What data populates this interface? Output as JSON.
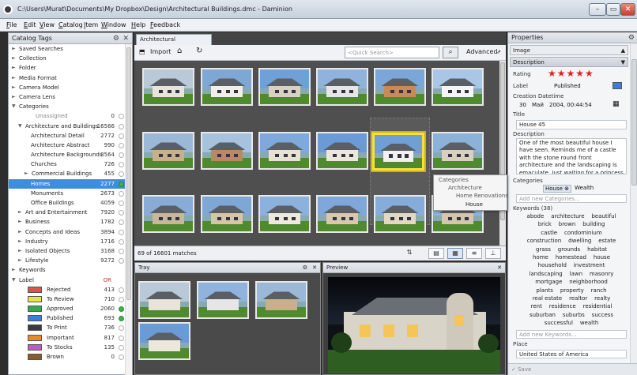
{
  "window": {
    "title": "C:\\Users\\Murat\\Documents\\My Dropbox\\Design\\Architectural Buildings.dmc - Daminion",
    "min": "–",
    "max": "▭",
    "close": "✕"
  },
  "menu": [
    "File",
    "Edit",
    "View",
    "Catalog",
    "Item",
    "Window",
    "Help",
    "Feedback"
  ],
  "left": {
    "title": "Catalog Tags",
    "items": [
      {
        "t": "Saved Searches",
        "d": 0,
        "a": "►"
      },
      {
        "t": "Collection",
        "d": 0,
        "a": "►"
      },
      {
        "t": "Folder",
        "d": 0,
        "a": "►"
      },
      {
        "t": "Media Format",
        "d": 0,
        "a": "►"
      },
      {
        "t": "Camera Model",
        "d": 0,
        "a": "►"
      },
      {
        "t": "Camera Lens",
        "d": 0,
        "a": "►"
      },
      {
        "t": "Categories",
        "d": 0,
        "a": "▼"
      },
      {
        "t": "Unassigned",
        "d": 2,
        "a": "",
        "c": "0",
        "dot": "w",
        "grey": true
      },
      {
        "t": "Architecture and Buildings",
        "d": 1,
        "a": "▼",
        "c": "16566",
        "dot": "w"
      },
      {
        "t": "Architectural Detail",
        "d": 3,
        "a": "",
        "c": "2772",
        "dot": "w"
      },
      {
        "t": "Architecture Abstract",
        "d": 3,
        "a": "",
        "c": "990",
        "dot": "w"
      },
      {
        "t": "Architecture Backgrounds",
        "d": 3,
        "a": "",
        "c": "3564",
        "dot": "w"
      },
      {
        "t": "Churches",
        "d": 3,
        "a": "",
        "c": "726",
        "dot": "w"
      },
      {
        "t": "Commercial Buildings",
        "d": 2,
        "a": "►",
        "c": "455",
        "dot": "w"
      },
      {
        "t": "Homes",
        "d": 3,
        "a": "",
        "c": "2277",
        "dot": "g",
        "sel": true
      },
      {
        "t": "Monuments",
        "d": 3,
        "a": "",
        "c": "2673",
        "dot": "w"
      },
      {
        "t": "Office Buildings",
        "d": 3,
        "a": "",
        "c": "4059",
        "dot": "w"
      },
      {
        "t": "Art and Entertainment",
        "d": 1,
        "a": "►",
        "c": "7920",
        "dot": "w"
      },
      {
        "t": "Business",
        "d": 1,
        "a": "►",
        "c": "1782",
        "dot": "w"
      },
      {
        "t": "Concepts and Ideas",
        "d": 1,
        "a": "►",
        "c": "3894",
        "dot": "w"
      },
      {
        "t": "Industry",
        "d": 1,
        "a": "►",
        "c": "1716",
        "dot": "w"
      },
      {
        "t": "Isolated Objects",
        "d": 1,
        "a": "►",
        "c": "3168",
        "dot": "w"
      },
      {
        "t": "Lifestyle",
        "d": 1,
        "a": "►",
        "c": "9272",
        "dot": "w"
      },
      {
        "t": "Keywords",
        "d": 0,
        "a": "►"
      },
      {
        "t": "Label",
        "d": 0,
        "a": "▼",
        "c": "OR",
        "dot": "",
        "or": true
      },
      {
        "t": "Rejected",
        "d": 4,
        "a": "",
        "c": "413",
        "dot": "w",
        "sw": "#d9534f"
      },
      {
        "t": "To Review",
        "d": 4,
        "a": "",
        "c": "710",
        "dot": "w",
        "sw": "#e5e54a"
      },
      {
        "t": "Approved",
        "d": 4,
        "a": "",
        "c": "2060",
        "dot": "g",
        "sw": "#3aa64a"
      },
      {
        "t": "Published",
        "d": 4,
        "a": "",
        "c": "693",
        "dot": "g",
        "sw": "#3d7ed8"
      },
      {
        "t": "To Print",
        "d": 4,
        "a": "",
        "c": "736",
        "dot": "w",
        "sw": "#3b3b3b"
      },
      {
        "t": "Important",
        "d": 4,
        "a": "",
        "c": "817",
        "dot": "w",
        "sw": "#e88a2a"
      },
      {
        "t": "To Stocks",
        "d": 4,
        "a": "",
        "c": "135",
        "dot": "w",
        "sw": "#c25ac2"
      },
      {
        "t": "Brown",
        "d": 4,
        "a": "",
        "c": "0",
        "dot": "w",
        "sw": "#8a5a2a"
      }
    ]
  },
  "doc_tab": "Architectural Buildings.dmc",
  "toolbar": {
    "import": "Import",
    "search_placeholder": "<Quick Search>",
    "advanced": "Advanced",
    "export": "Export"
  },
  "status": {
    "matches": "69 of 16601 matches"
  },
  "tray_title": "Tray",
  "preview_title": "Preview",
  "tooltip": {
    "l1": "Categories",
    "l2": "Architecture",
    "l3": "Home Renovations",
    "l4": "House"
  },
  "props": {
    "title": "Properties",
    "selector": "Image",
    "section_desc": "Description",
    "rating_label": "Rating",
    "stars": "★★★★★",
    "label_label": "Label",
    "label_value": "Published",
    "created_label": "Creation Datetime",
    "created_day": "30",
    "created_month": "Май",
    "created_rest": "2004, 00:44:54",
    "title_label": "Title",
    "title_value": "House 45",
    "desc_label": "Description",
    "desc_value": "One of the most beautiful house I have seen. Reminds me of a castle with the stone round front architecture and the landscaping is emaculate. Just waiting for a princess to walk out.",
    "cat_label": "Categories",
    "cat_1": "House",
    "cat_2": "Wealth",
    "add_cat": "Add new Categories...",
    "kw_label": "Keywords (38)",
    "kw_lines": [
      "abode    architecture    beautiful",
      "brick    brown    building",
      "castle    condominium",
      "construction    dwelling    estate",
      "grass    grounds    habitat",
      "home    homestead    house",
      "household    investment",
      "landscaping    lawn    masonry",
      "mortgage    neighborhood",
      "plants    property    ranch",
      "real estate    realtor    realty",
      "rent    residence    residential",
      "suburban    suburbs    success",
      "successful    wealth"
    ],
    "add_kw": "Add new Keywords...",
    "place_label": "Place",
    "place_value": "United States of America",
    "save": "Save"
  }
}
